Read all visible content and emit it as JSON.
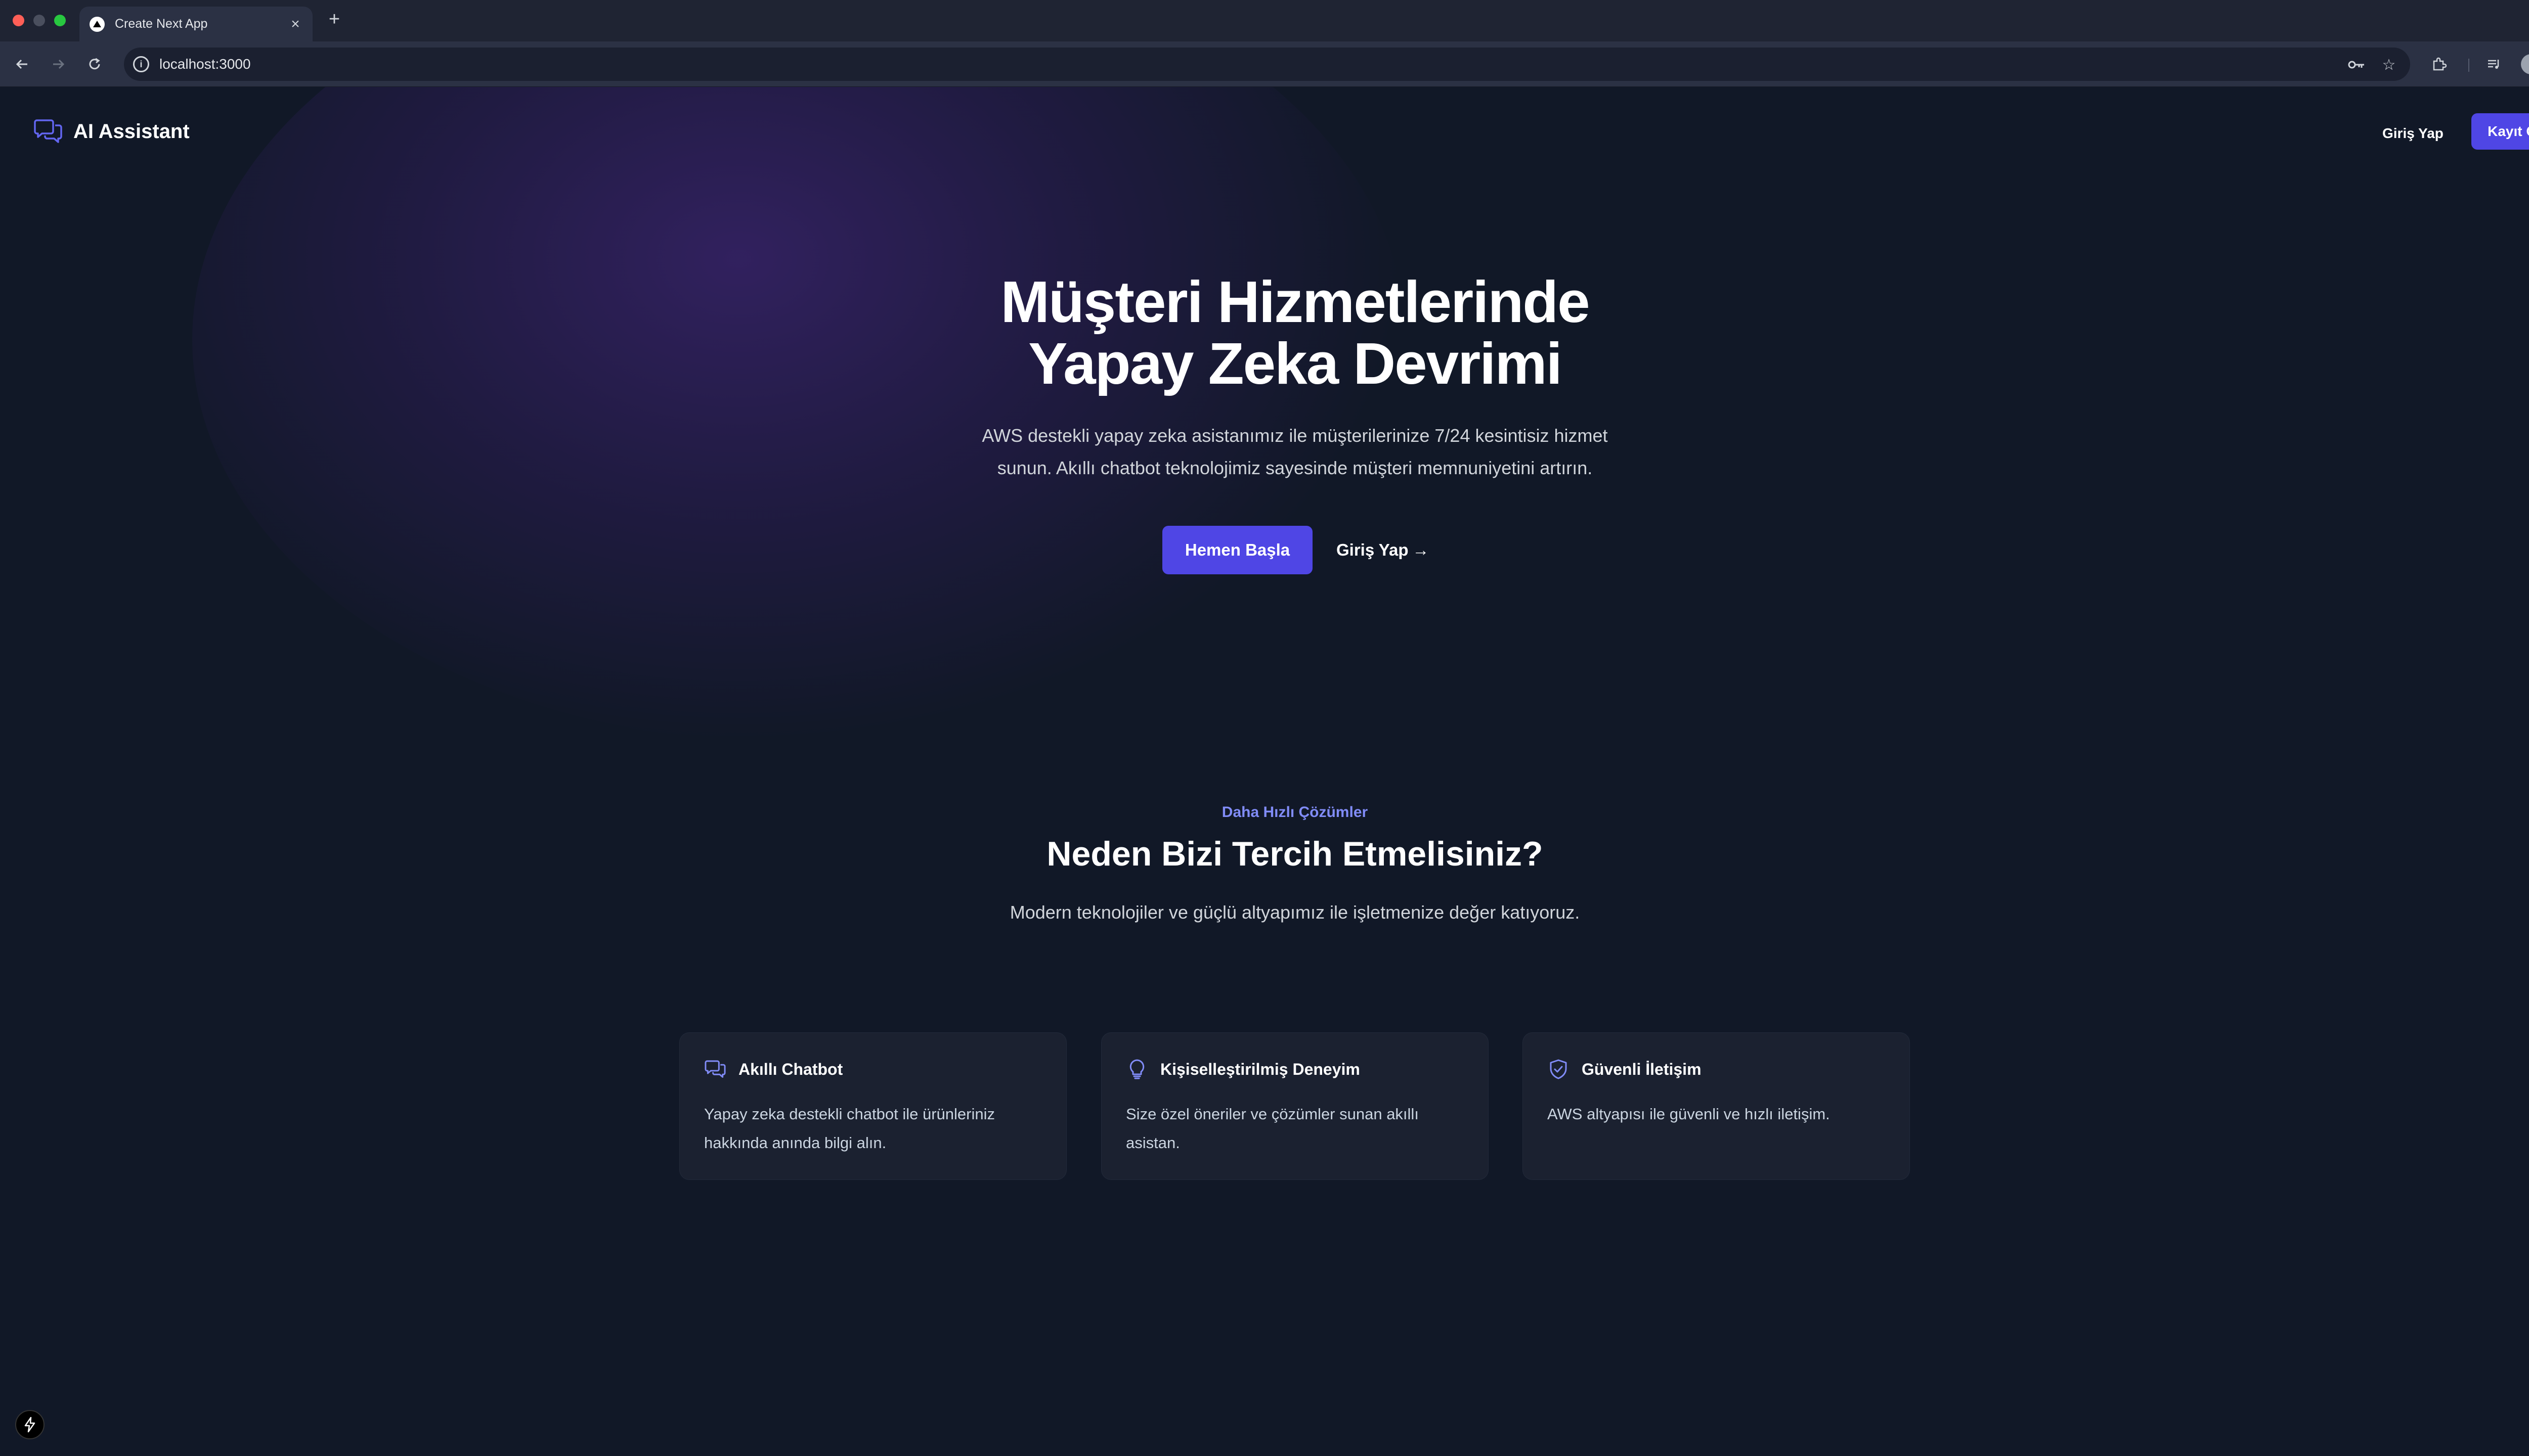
{
  "browser": {
    "tab_title": "Create Next App",
    "url": "localhost:3000"
  },
  "header": {
    "brand": "AI Assistant",
    "login": "Giriş Yap",
    "signup": "Kayıt Ol"
  },
  "hero": {
    "title_line1": "Müşteri Hizmetlerinde",
    "title_line2": "Yapay Zeka Devrimi",
    "description": "AWS destekli yapay zeka asistanımız ile müşterilerinize 7/24 kesintisiz hizmet sunun. Akıllı chatbot teknolojimiz sayesinde müşteri memnuniyetini artırın.",
    "primary_cta": "Hemen Başla",
    "secondary_cta": "Giriş Yap",
    "secondary_arrow": "→"
  },
  "features": {
    "eyebrow": "Daha Hızlı Çözümler",
    "title": "Neden Bizi Tercih Etmelisiniz?",
    "description": "Modern teknolojiler ve güçlü altyapımız ile işletmenize değer katıyoruz.",
    "cards": [
      {
        "icon": "chat-bubbles-icon",
        "title": "Akıllı Chatbot",
        "text": "Yapay zeka destekli chatbot ile ürünleriniz hakkında anında bilgi alın."
      },
      {
        "icon": "lightbulb-icon",
        "title": "Kişiselleştirilmiş Deneyim",
        "text": "Size özel öneriler ve çözümler sunan akıllı asistan."
      },
      {
        "icon": "shield-check-icon",
        "title": "Güvenli İletişim",
        "text": "AWS altyapısı ile güvenli ve hızlı iletişim."
      }
    ]
  },
  "colors": {
    "background": "#111827",
    "accent": "#4f46e5",
    "eyebrow": "#818cf8",
    "card": "#1b2130"
  }
}
